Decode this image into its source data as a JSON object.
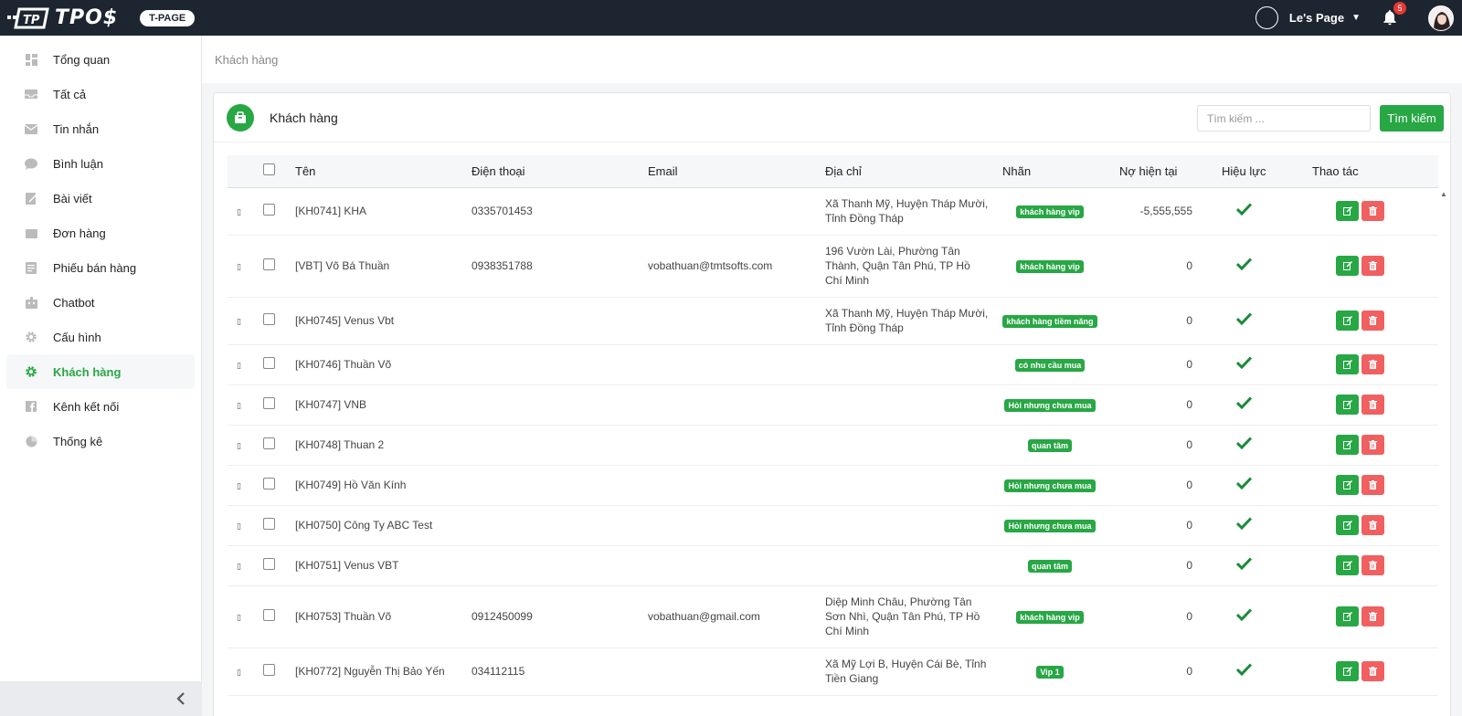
{
  "brand": {
    "name": "TPO$",
    "badge": "T-PAGE"
  },
  "user": {
    "page_name": "Le's Page",
    "notifications": "5"
  },
  "sidebar": {
    "items": [
      {
        "label": "Tổng quan",
        "icon": "dashboard-icon"
      },
      {
        "label": "Tất cả",
        "icon": "inbox-icon"
      },
      {
        "label": "Tin nhắn",
        "icon": "mail-icon"
      },
      {
        "label": "Bình luận",
        "icon": "comment-icon"
      },
      {
        "label": "Bài viết",
        "icon": "edit-icon"
      },
      {
        "label": "Đơn hàng",
        "icon": "cart-icon"
      },
      {
        "label": "Phiếu bán hàng",
        "icon": "receipt-icon"
      },
      {
        "label": "Chatbot",
        "icon": "robot-icon"
      },
      {
        "label": "Cấu hình",
        "icon": "gear-icon"
      },
      {
        "label": "Khách hàng",
        "icon": "gear-icon",
        "active": true
      },
      {
        "label": "Kênh kết nối",
        "icon": "facebook-icon"
      },
      {
        "label": "Thống kê",
        "icon": "pie-chart-icon"
      }
    ]
  },
  "breadcrumb": "Khách hàng",
  "card": {
    "title": "Khách hàng"
  },
  "search": {
    "placeholder": "Tìm kiếm ...",
    "button": "Tìm kiếm"
  },
  "table": {
    "columns": [
      "Tên",
      "Điện thoại",
      "Email",
      "Địa chỉ",
      "Nhãn",
      "Nợ hiện tại",
      "Hiệu lực",
      "Thao tác"
    ],
    "rows": [
      {
        "name": "[KH0741] KHA",
        "phone": "0335701453",
        "email": "",
        "address": "Xã Thanh Mỹ, Huyện Tháp Mười, Tỉnh Đồng Tháp",
        "tag": "khách hàng vip",
        "debt": "-5,555,555"
      },
      {
        "name": "[VBT] Võ Bá Thuần",
        "phone": "0938351788",
        "email": "vobathuan@tmtsofts.com",
        "address": "196 Vườn Lài, Phường Tân Thành, Quận Tân Phú, TP Hồ Chí Minh",
        "tag": "khách hàng vip",
        "debt": "0"
      },
      {
        "name": "[KH0745] Venus Vbt",
        "phone": "",
        "email": "",
        "address": "Xã Thanh Mỹ, Huyện Tháp Mười, Tỉnh Đồng Tháp",
        "tag": "khách hàng tiềm năng",
        "debt": "0"
      },
      {
        "name": "[KH0746] Thuần Võ",
        "phone": "",
        "email": "",
        "address": "",
        "tag": "có nhu cầu mua",
        "debt": "0"
      },
      {
        "name": "[KH0747] VNB",
        "phone": "",
        "email": "",
        "address": "",
        "tag": "Hỏi nhưng chưa mua",
        "debt": "0"
      },
      {
        "name": "[KH0748] Thuan 2",
        "phone": "",
        "email": "",
        "address": "",
        "tag": "quan tâm",
        "debt": "0"
      },
      {
        "name": "[KH0749] Hồ Văn Kính",
        "phone": "",
        "email": "",
        "address": "",
        "tag": "Hỏi nhưng chưa mua",
        "debt": "0"
      },
      {
        "name": "[KH0750] Công Ty ABC Test",
        "phone": "",
        "email": "",
        "address": "",
        "tag": "Hỏi nhưng chưa mua",
        "debt": "0"
      },
      {
        "name": "[KH0751] Venus VBT",
        "phone": "",
        "email": "",
        "address": "",
        "tag": "quan tâm",
        "debt": "0"
      },
      {
        "name": "[KH0753] Thuần Võ",
        "phone": "0912450099",
        "email": "vobathuan@gmail.com",
        "address": "Diệp Minh Châu, Phường Tân Sơn Nhì, Quận Tân Phú, TP Hồ Chí Minh",
        "tag": "khách hàng vip",
        "debt": "0"
      },
      {
        "name": "[KH0772] Nguyễn Thị Bảo Yến",
        "phone": "034112115",
        "email": "",
        "address": "Xã Mỹ Lợi B, Huyện Cái Bè, Tỉnh Tiền Giang",
        "tag": "Vip 1",
        "debt": "0"
      }
    ]
  },
  "colors": {
    "accent": "#28a745",
    "danger": "#f06060",
    "topbar": "#1c2530"
  }
}
